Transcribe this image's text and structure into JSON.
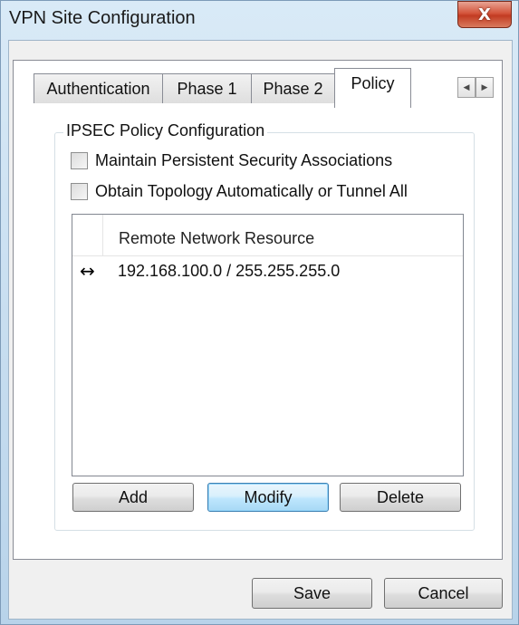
{
  "window": {
    "title": "VPN Site Configuration",
    "close_glyph": "X"
  },
  "tabs": [
    {
      "label": "Authentication",
      "active": false
    },
    {
      "label": "Phase 1",
      "active": false
    },
    {
      "label": "Phase 2",
      "active": false
    },
    {
      "label": "Policy",
      "active": true
    }
  ],
  "tab_scroll": {
    "left_icon": "◀",
    "right_icon": "▶"
  },
  "policy": {
    "group_title": "IPSEC Policy Configuration",
    "checkboxes": [
      {
        "label": "Maintain Persistent Security Associations",
        "checked": false
      },
      {
        "label": "Obtain Topology Automatically or Tunnel All",
        "checked": false
      }
    ],
    "list": {
      "column_header": "Remote Network Resource",
      "rows": [
        {
          "icon": "bidirectional-arrow-icon",
          "glyph": "↔",
          "value": "192.168.100.0 / 255.255.255.0"
        }
      ]
    },
    "buttons": {
      "add": "Add",
      "modify": "Modify",
      "delete": "Delete"
    }
  },
  "dialog_buttons": {
    "save": "Save",
    "cancel": "Cancel"
  },
  "colors": {
    "close_button": "#c23b22",
    "title_bar": "#c5dcef",
    "focused_button_border": "#3c7fb1"
  }
}
